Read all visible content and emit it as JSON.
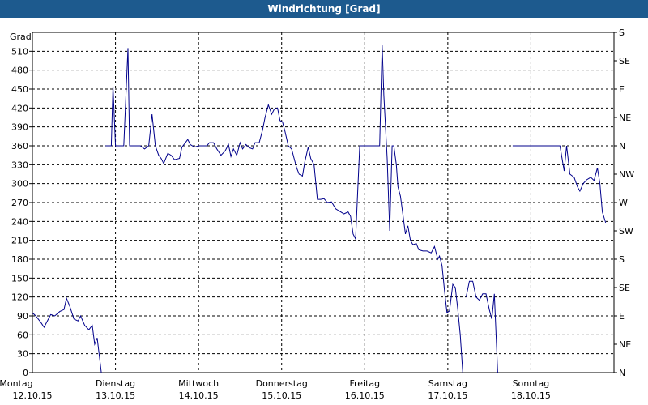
{
  "window": {
    "title": "Windrichtung [Grad]"
  },
  "chart_data": {
    "type": "line",
    "title": "Windrichtung [Grad]",
    "ylabel": "Grad",
    "ylim": [
      0,
      540
    ],
    "yticks": [
      0,
      30,
      60,
      90,
      120,
      150,
      180,
      210,
      240,
      270,
      300,
      330,
      360,
      390,
      420,
      450,
      480,
      510
    ],
    "right_ticks": [
      {
        "value": 0,
        "label": "N"
      },
      {
        "value": 45,
        "label": "NE"
      },
      {
        "value": 90,
        "label": "E"
      },
      {
        "value": 135,
        "label": "SE"
      },
      {
        "value": 180,
        "label": "S"
      },
      {
        "value": 225,
        "label": "SW"
      },
      {
        "value": 270,
        "label": "W"
      },
      {
        "value": 315,
        "label": "NW"
      },
      {
        "value": 360,
        "label": "N"
      },
      {
        "value": 405,
        "label": "NE"
      },
      {
        "value": 450,
        "label": "E"
      },
      {
        "value": 495,
        "label": "SE"
      },
      {
        "value": 540,
        "label": "S"
      }
    ],
    "xlim": [
      0,
      7
    ],
    "days": [
      {
        "day": "Montag",
        "date": "12.10.15"
      },
      {
        "day": "Dienstag",
        "date": "13.10.15"
      },
      {
        "day": "Mittwoch",
        "date": "14.10.15"
      },
      {
        "day": "Donnerstag",
        "date": "15.10.15"
      },
      {
        "day": "Freitag",
        "date": "16.10.15"
      },
      {
        "day": "Samstag",
        "date": "17.10.15"
      },
      {
        "day": "Sonntag",
        "date": "18.10.15"
      }
    ],
    "grid": true,
    "line_color": "#00008b",
    "series": [
      {
        "name": "",
        "segments": [
          [
            [
              0.0,
              95
            ],
            [
              0.04,
              90
            ],
            [
              0.1,
              80
            ],
            [
              0.14,
              72
            ],
            [
              0.22,
              92
            ],
            [
              0.27,
              90
            ],
            [
              0.33,
              97
            ],
            [
              0.38,
              100
            ],
            [
              0.41,
              118
            ],
            [
              0.45,
              105
            ],
            [
              0.5,
              85
            ],
            [
              0.55,
              82
            ],
            [
              0.58,
              90
            ],
            [
              0.63,
              75
            ],
            [
              0.68,
              68
            ],
            [
              0.72,
              75
            ],
            [
              0.75,
              45
            ],
            [
              0.78,
              55
            ],
            [
              0.83,
              0
            ]
          ],
          [
            [
              0.88,
              360
            ],
            [
              0.95,
              360
            ],
            [
              0.97,
              455
            ],
            [
              1.0,
              360
            ],
            [
              1.1,
              360
            ],
            [
              1.15,
              515
            ],
            [
              1.17,
              360
            ],
            [
              1.3,
              360
            ],
            [
              1.35,
              355
            ],
            [
              1.4,
              360
            ],
            [
              1.42,
              385
            ],
            [
              1.44,
              410
            ],
            [
              1.48,
              360
            ],
            [
              1.52,
              345
            ],
            [
              1.55,
              340
            ],
            [
              1.58,
              332
            ],
            [
              1.63,
              348
            ],
            [
              1.67,
              345
            ],
            [
              1.71,
              338
            ],
            [
              1.77,
              340
            ],
            [
              1.8,
              358
            ],
            [
              1.83,
              363
            ],
            [
              1.87,
              370
            ],
            [
              1.9,
              362
            ],
            [
              1.95,
              358
            ],
            [
              2.0,
              360
            ],
            [
              2.05,
              360
            ],
            [
              2.1,
              360
            ],
            [
              2.13,
              365
            ],
            [
              2.18,
              365
            ],
            [
              2.22,
              355
            ],
            [
              2.27,
              345
            ],
            [
              2.32,
              352
            ],
            [
              2.36,
              362
            ],
            [
              2.39,
              343
            ],
            [
              2.42,
              355
            ],
            [
              2.46,
              345
            ],
            [
              2.5,
              365
            ],
            [
              2.53,
              355
            ],
            [
              2.57,
              362
            ],
            [
              2.61,
              357
            ],
            [
              2.65,
              355
            ],
            [
              2.68,
              365
            ],
            [
              2.73,
              365
            ],
            [
              2.77,
              385
            ],
            [
              2.8,
              405
            ],
            [
              2.84,
              425
            ],
            [
              2.88,
              410
            ],
            [
              2.91,
              418
            ],
            [
              2.95,
              420
            ],
            [
              2.98,
              400
            ],
            [
              3.01,
              398
            ],
            [
              3.04,
              383
            ],
            [
              3.08,
              360
            ],
            [
              3.12,
              355
            ],
            [
              3.15,
              340
            ],
            [
              3.18,
              325
            ],
            [
              3.21,
              315
            ],
            [
              3.25,
              312
            ],
            [
              3.28,
              335
            ],
            [
              3.32,
              358
            ],
            [
              3.35,
              340
            ],
            [
              3.39,
              330
            ],
            [
              3.43,
              275
            ],
            [
              3.47,
              275
            ],
            [
              3.51,
              276
            ],
            [
              3.55,
              270
            ],
            [
              3.6,
              271
            ],
            [
              3.65,
              260
            ],
            [
              3.7,
              256
            ],
            [
              3.75,
              252
            ],
            [
              3.8,
              255
            ],
            [
              3.83,
              248
            ],
            [
              3.86,
              220
            ],
            [
              3.89,
              212
            ],
            [
              3.94,
              360
            ],
            [
              4.0,
              360
            ],
            [
              4.1,
              360
            ],
            [
              4.18,
              360
            ],
            [
              4.21,
              520
            ],
            [
              4.23,
              440
            ],
            [
              4.27,
              340
            ],
            [
              4.3,
              225
            ],
            [
              4.33,
              360
            ],
            [
              4.35,
              360
            ],
            [
              4.38,
              330
            ],
            [
              4.4,
              295
            ],
            [
              4.43,
              280
            ],
            [
              4.46,
              250
            ],
            [
              4.49,
              220
            ],
            [
              4.52,
              233
            ],
            [
              4.55,
              210
            ],
            [
              4.58,
              203
            ],
            [
              4.62,
              205
            ],
            [
              4.65,
              195
            ],
            [
              4.7,
              193
            ],
            [
              4.75,
              193
            ],
            [
              4.8,
              190
            ],
            [
              4.84,
              200
            ],
            [
              4.88,
              180
            ],
            [
              4.9,
              185
            ],
            [
              4.93,
              170
            ],
            [
              4.96,
              130
            ],
            [
              4.99,
              95
            ],
            [
              5.02,
              98
            ],
            [
              5.06,
              140
            ],
            [
              5.09,
              135
            ],
            [
              5.12,
              100
            ],
            [
              5.15,
              60
            ],
            [
              5.18,
              0
            ]
          ],
          [
            [
              5.22,
              120
            ],
            [
              5.26,
              145
            ],
            [
              5.3,
              145
            ],
            [
              5.34,
              120
            ],
            [
              5.38,
              115
            ],
            [
              5.42,
              125
            ],
            [
              5.46,
              125
            ],
            [
              5.5,
              100
            ],
            [
              5.53,
              85
            ],
            [
              5.56,
              125
            ],
            [
              5.6,
              0
            ]
          ],
          [
            [
              5.78,
              360
            ],
            [
              5.9,
              360
            ],
            [
              6.0,
              360
            ],
            [
              6.1,
              360
            ],
            [
              6.2,
              360
            ],
            [
              6.3,
              360
            ],
            [
              6.35,
              360
            ],
            [
              6.4,
              320
            ],
            [
              6.43,
              360
            ],
            [
              6.47,
              315
            ],
            [
              6.52,
              310
            ],
            [
              6.56,
              295
            ],
            [
              6.59,
              288
            ],
            [
              6.63,
              300
            ],
            [
              6.67,
              306
            ],
            [
              6.72,
              310
            ],
            [
              6.76,
              305
            ],
            [
              6.8,
              325
            ],
            [
              6.83,
              300
            ],
            [
              6.86,
              255
            ],
            [
              6.9,
              238
            ]
          ]
        ]
      }
    ]
  }
}
